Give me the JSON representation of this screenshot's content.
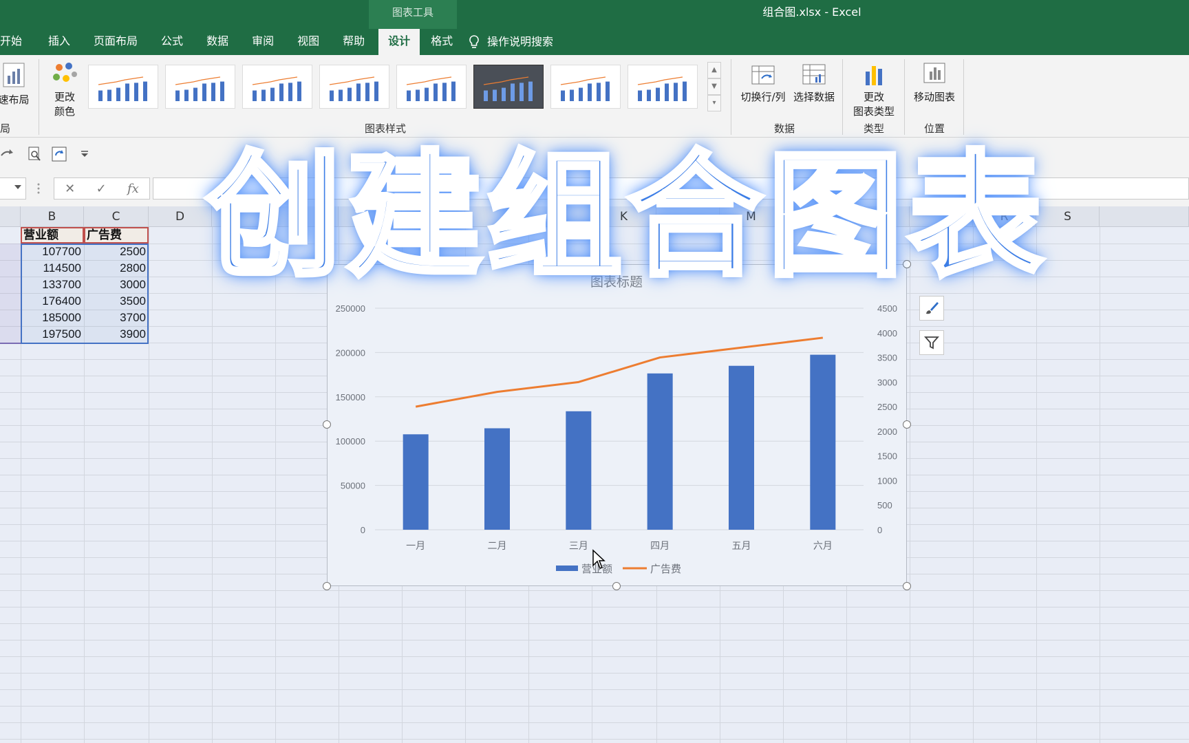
{
  "window": {
    "chart_tools_label": "图表工具",
    "doc_title": "组合图.xlsx  -  Excel"
  },
  "tabs": [
    {
      "label": "开始"
    },
    {
      "label": "插入"
    },
    {
      "label": "页面布局"
    },
    {
      "label": "公式"
    },
    {
      "label": "数据"
    },
    {
      "label": "审阅"
    },
    {
      "label": "视图"
    },
    {
      "label": "帮助"
    },
    {
      "label": "设计"
    },
    {
      "label": "格式"
    }
  ],
  "tell_me": "操作说明搜索",
  "ribbon": {
    "quick_layout": "速布局",
    "change_colors_1": "更改",
    "change_colors_2": "颜色",
    "styles_group": "图表样式",
    "switch_row_col": "切换行/列",
    "select_data": "选择数据",
    "data_group": "数据",
    "change_type_1": "更改",
    "change_type_2": "图表类型",
    "type_group": "类型",
    "move_chart": "移动图表",
    "location_group": "位置",
    "layout_group_partial": "局"
  },
  "formula_bar": {
    "fx": "fx"
  },
  "grid": {
    "columns": [
      "B",
      "C",
      "D",
      "K",
      "M",
      "R",
      "S"
    ],
    "header_b": "营业额",
    "header_c": "广告费",
    "rows": [
      {
        "b": "107700",
        "c": "2500"
      },
      {
        "b": "114500",
        "c": "2800"
      },
      {
        "b": "133700",
        "c": "3000"
      },
      {
        "b": "176400",
        "c": "3500"
      },
      {
        "b": "185000",
        "c": "3700"
      },
      {
        "b": "197500",
        "c": "3900"
      }
    ]
  },
  "chart_data": {
    "type": "bar",
    "title": "图表标题",
    "categories": [
      "一月",
      "二月",
      "三月",
      "四月",
      "五月",
      "六月"
    ],
    "series": [
      {
        "name": "营业额",
        "type": "bar",
        "axis": "primary",
        "color": "#4472c4",
        "values": [
          107700,
          114500,
          133700,
          176400,
          185000,
          197500
        ]
      },
      {
        "name": "广告费",
        "type": "line",
        "axis": "secondary",
        "color": "#ed7d31",
        "values": [
          2500,
          2800,
          3000,
          3500,
          3700,
          3900
        ]
      }
    ],
    "ylim": [
      0,
      250000
    ],
    "yticks": [
      0,
      50000,
      100000,
      150000,
      200000,
      250000
    ],
    "y2lim": [
      0,
      4500
    ],
    "y2ticks": [
      0,
      500,
      1000,
      1500,
      2000,
      2500,
      3000,
      3500,
      4000,
      4500
    ],
    "grid": true,
    "legend": "bottom"
  },
  "overlay_title": "创建组合图表",
  "colors": {
    "titlebar": "#1f6d44",
    "bar": "#4472c4",
    "line": "#ed7d31"
  }
}
